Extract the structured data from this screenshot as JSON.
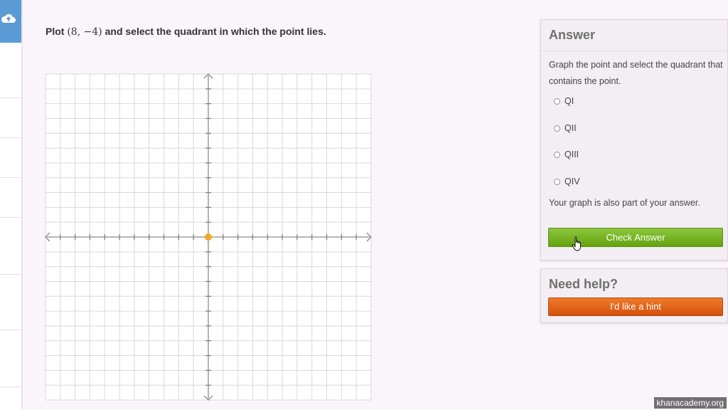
{
  "question": {
    "prefix": "Plot",
    "math": "(8, −4)",
    "suffix": "and select the quadrant in which the point lies."
  },
  "graph": {
    "x_range": [
      -11,
      11
    ],
    "y_range": [
      -11,
      11
    ],
    "grid_step": 1,
    "grid": true,
    "point": {
      "x": 0,
      "y": 0,
      "color": "#f5a623"
    }
  },
  "answer_panel": {
    "title": "Answer",
    "prompt": "Graph the point and select the quadrant that contains the point.",
    "options": [
      "QI",
      "QII",
      "QIII",
      "QIV"
    ],
    "note": "Your graph is also part of your answer.",
    "check_button": "Check Answer"
  },
  "help_panel": {
    "title": "Need help?",
    "hint_button": "I'd like a hint"
  },
  "watermark": "khanacademy.org",
  "colors": {
    "check": "#76b82a",
    "hint": "#e2621b",
    "rail_accent": "#5b9bd5",
    "point": "#f5a623"
  },
  "icons": [
    "cloud-upload-icon",
    "hand-pointer-icon"
  ]
}
